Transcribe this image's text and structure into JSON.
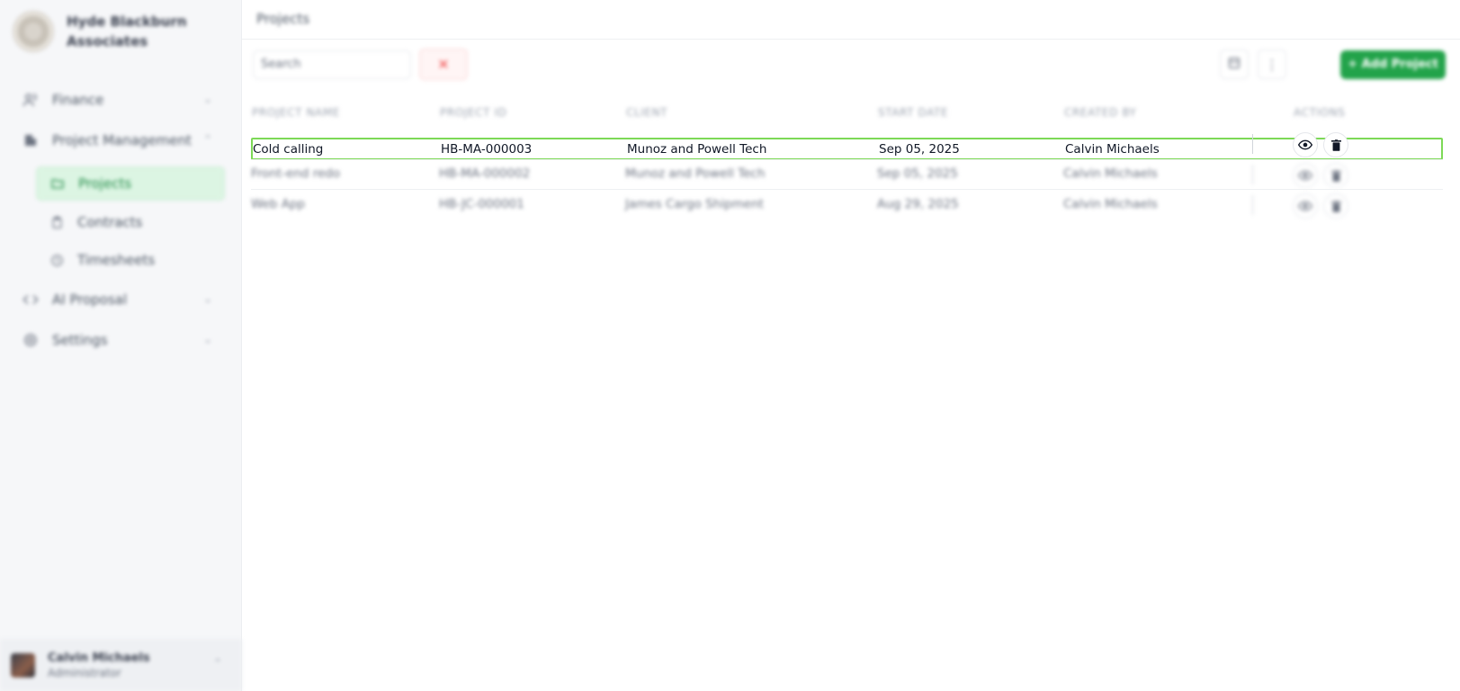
{
  "sidebar": {
    "org_name": "Hyde Blackburn Associates",
    "nav": [
      {
        "label": "Finance",
        "icon": "users-icon"
      },
      {
        "label": "Project Management",
        "icon": "building-icon"
      },
      {
        "label": "AI Proposal",
        "icon": "code-icon"
      },
      {
        "label": "Settings",
        "icon": "gear-icon"
      }
    ],
    "sub_items": [
      {
        "label": "Projects",
        "icon": "folder-icon",
        "active": true
      },
      {
        "label": "Contracts",
        "icon": "clipboard-icon"
      },
      {
        "label": "Timesheets",
        "icon": "clock-icon"
      }
    ],
    "user": {
      "name": "Calvin Michaels",
      "role": "Administrator"
    }
  },
  "main": {
    "title": "Projects",
    "search_placeholder": "Search",
    "clear_label": "✕",
    "add_label": "+ Add Project",
    "columns": [
      "PROJECT NAME",
      "PROJECT ID",
      "CLIENT",
      "START DATE",
      "CREATED BY",
      "ACTIONS"
    ],
    "rows": [
      {
        "name": "Cold calling",
        "id": "HB-MA-000003",
        "client": "Munoz and Powell Tech",
        "start": "Sep 05, 2025",
        "created_by": "Calvin Michaels"
      },
      {
        "name": "Front-end redo",
        "id": "HB-MA-000002",
        "client": "Munoz and Powell Tech",
        "start": "Sep 05, 2025",
        "created_by": "Calvin Michaels"
      },
      {
        "name": "Web App",
        "id": "HB-JC-000001",
        "client": "James Cargo Shipment",
        "start": "Aug 29, 2025",
        "created_by": "Calvin Michaels"
      }
    ]
  },
  "colors": {
    "accent": "#22a34a",
    "highlight_border": "#7dd957",
    "active_bg": "#dcf5e3"
  }
}
